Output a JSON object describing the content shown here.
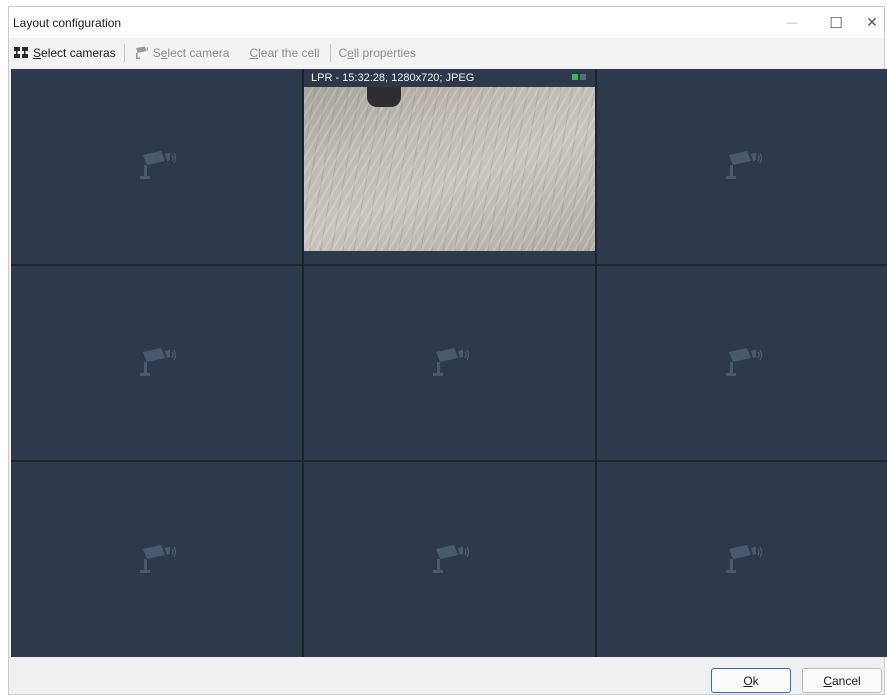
{
  "window": {
    "title": "Layout configuration",
    "minimize_glyph": "—",
    "maximize_glyph": "☐",
    "close_glyph": "✕"
  },
  "toolbar": {
    "select_cameras": {
      "access_key": "S",
      "rest": "elect cameras",
      "icon": "camera-group-icon"
    },
    "select_camera": {
      "pre": "S",
      "access_key": "e",
      "rest": "lect camera",
      "icon": "camera-icon"
    },
    "clear_cell": {
      "access_key": "C",
      "rest": "lear the cell"
    },
    "cell_properties": {
      "pre": "C",
      "access_key": "e",
      "rest": "ll properties"
    }
  },
  "grid": {
    "rows": 3,
    "columns": 3,
    "active_cell": {
      "row": 1,
      "column": 2,
      "overlay_text": "LPR - 15:32:28; 1280x720; JPEG",
      "status_colors": [
        "#29c24a",
        "#5b6b80"
      ]
    },
    "empty_cell_icon": "surveillance-camera-icon",
    "colors": {
      "cell_bg": "#2d3a4b",
      "grid_line": "#1c2430",
      "icon": "#4a5a6d"
    }
  },
  "footer": {
    "ok": {
      "access_key": "O",
      "rest": "k"
    },
    "cancel": {
      "access_key": "C",
      "rest": "ancel"
    }
  }
}
